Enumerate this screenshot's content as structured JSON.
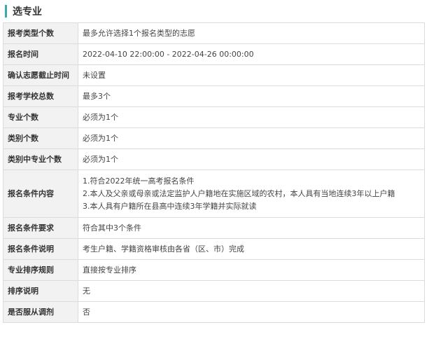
{
  "section_title": "选专业",
  "rows": [
    {
      "label": "报考类型个数",
      "value": "最多允许选择1个报名类型的志愿"
    },
    {
      "label": "报名时间",
      "value": "2022-04-10 22:00:00 - 2022-04-26 00:00:00"
    },
    {
      "label": "确认志愿截止时间",
      "value": "未设置"
    },
    {
      "label": "报考学校总数",
      "value": "最多3个"
    },
    {
      "label": "专业个数",
      "value": "必须为1个"
    },
    {
      "label": "类别个数",
      "value": "必须为1个"
    },
    {
      "label": "类别中专业个数",
      "value": "必须为1个"
    },
    {
      "label": "报名条件内容",
      "lines": [
        "1.符合2022年统一高考报名条件",
        "2.本人及父亲或母亲或法定监护人户籍地在实施区域的农村，本人具有当地连续3年以上户籍",
        "3.本人具有户籍所在县高中连续3年学籍并实际就读"
      ]
    },
    {
      "label": "报名条件要求",
      "value": "符合其中3个条件"
    },
    {
      "label": "报名条件说明",
      "value": "考生户籍、学籍资格审核由各省（区、市）完成"
    },
    {
      "label": "专业排序规则",
      "value": "直接按专业排序"
    },
    {
      "label": "排序说明",
      "value": "无"
    },
    {
      "label": "是否服从调剂",
      "value": "否"
    }
  ],
  "colors": {
    "accent": "#3aa7b3",
    "label_bg": "#f2f2f2",
    "border": "#dcdcdc"
  }
}
